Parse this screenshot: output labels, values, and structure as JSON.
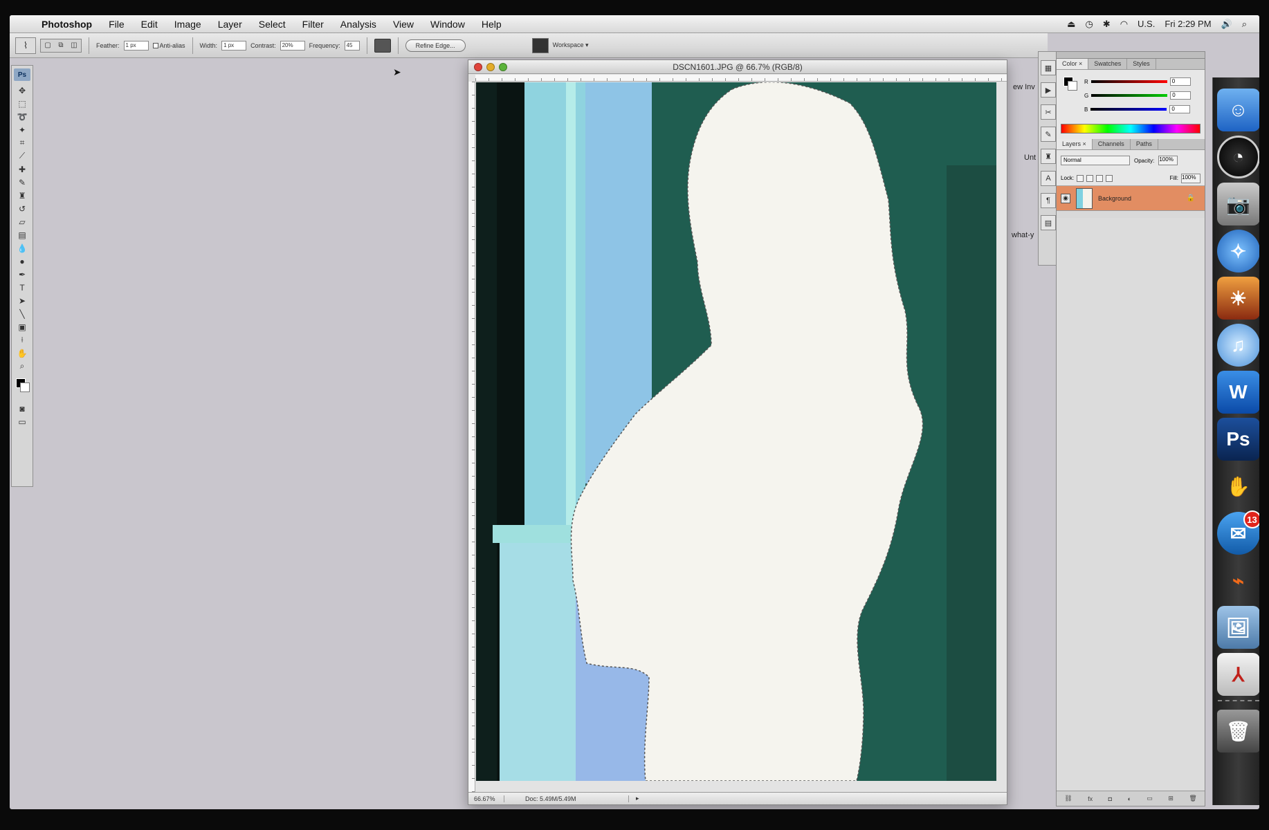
{
  "menubar": {
    "app_name": "Photoshop",
    "menus": [
      "File",
      "Edit",
      "Image",
      "Layer",
      "Select",
      "Filter",
      "Analysis",
      "View",
      "Window",
      "Help"
    ],
    "status": {
      "input_source": "U.S.",
      "clock": "Fri 2:29 PM"
    }
  },
  "options_bar": {
    "feather_label": "Feather:",
    "feather_value": "1 px",
    "antialias_label": "Anti-alias",
    "width_label": "Width:",
    "width_value": "1 px",
    "contrast_label": "Contrast:",
    "contrast_value": "20%",
    "frequency_label": "Frequency:",
    "frequency_value": "45",
    "refine_edge_label": "Refine Edge...",
    "workspace_label": "Workspace ▾"
  },
  "toolbox": {
    "logo": "Ps"
  },
  "document": {
    "title": "DSCN1601.JPG @ 66.7% (RGB/8)",
    "zoom": "66.67%",
    "doc_info": "Doc: 5.49M/5.49M"
  },
  "color_panel": {
    "tabs": [
      "Color ×",
      "Swatches",
      "Styles"
    ],
    "r_label": "R",
    "g_label": "G",
    "b_label": "B",
    "r_value": "0",
    "g_value": "0",
    "b_value": "0"
  },
  "layers_panel": {
    "tabs": [
      "Layers ×",
      "Channels",
      "Paths"
    ],
    "blend_mode": "Normal",
    "opacity_label": "Opacity:",
    "opacity_value": "100%",
    "lock_label": "Lock:",
    "fill_label": "Fill:",
    "fill_value": "100%",
    "layer_name": "Background"
  },
  "peek_text": {
    "a": "ew Inv",
    "b": "Unt",
    "c": "what-y"
  },
  "dock": {
    "mail_badge": "13"
  }
}
